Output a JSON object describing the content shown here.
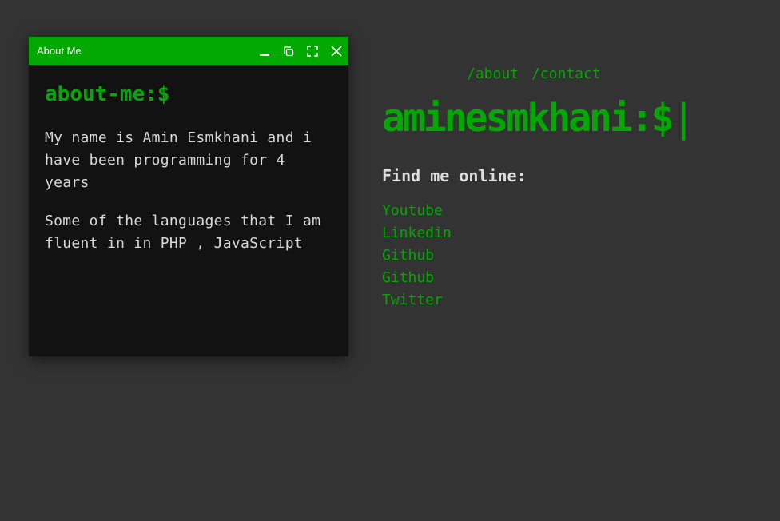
{
  "window": {
    "title": "About Me",
    "controls": [
      {
        "name": "minimize",
        "icon": "minimize-icon"
      },
      {
        "name": "restore",
        "icon": "restore-icon"
      },
      {
        "name": "maximize",
        "icon": "fullscreen-icon"
      },
      {
        "name": "close",
        "icon": "close-icon"
      }
    ],
    "prompt": "about-me:$",
    "paragraphs": [
      "My name is Amin Esmkhani and i have been programming for 4 years",
      "Some of the languages that I am fluent in in PHP , JavaScript"
    ]
  },
  "nav": {
    "items": [
      "/about",
      "/contact"
    ]
  },
  "brand": {
    "text": "aminesmkhani:$",
    "cursor": "|"
  },
  "online": {
    "heading": "Find me online:",
    "links": [
      "Youtube",
      "Linkedin",
      "Github",
      "Github",
      "Twitter"
    ]
  },
  "colors": {
    "accent": "#00a800",
    "background": "#333333",
    "window_bg": "#121212",
    "text": "#d8d8d8"
  }
}
